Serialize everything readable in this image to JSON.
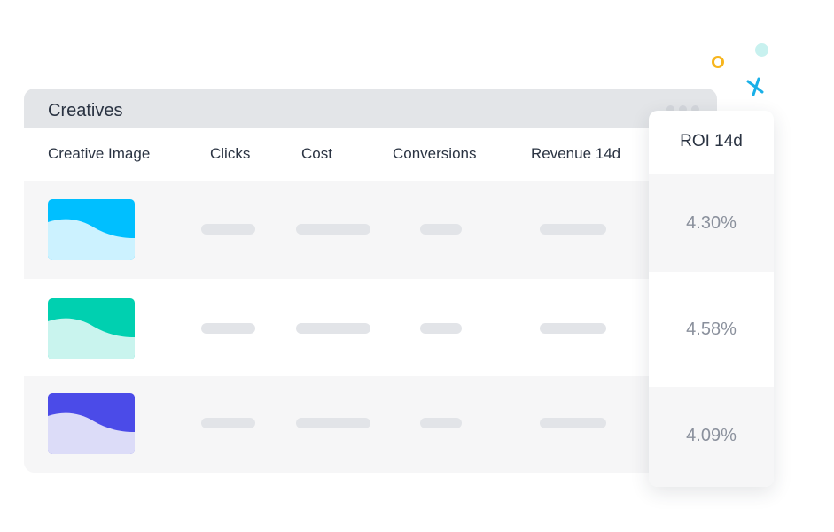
{
  "table": {
    "title": "Creatives",
    "columns": {
      "creative_image": "Creative Image",
      "clicks": "Clicks",
      "cost": "Cost",
      "conversions": "Conversions",
      "revenue": "Revenue 14d",
      "roi": "ROI 14d"
    },
    "rows": [
      {
        "roi": "4.30%",
        "thumb_top": "#00bfff",
        "thumb_bottom": "#ccf2ff"
      },
      {
        "roi": "4.58%",
        "thumb_top": "#00d0b0",
        "thumb_bottom": "#c9f4ee"
      },
      {
        "roi": "4.09%",
        "thumb_top": "#4b4be8",
        "thumb_bottom": "#dcdcf8"
      }
    ]
  },
  "colors": {
    "header_bg": "#e3e5e8",
    "row_shaded": "#f6f6f7",
    "placeholder_bar": "#e2e4e8",
    "roi_text": "#8a909c",
    "decor_ring": "#f7b51d",
    "decor_dot": "#c8f1ef",
    "decor_x": "#1ab0e8"
  }
}
